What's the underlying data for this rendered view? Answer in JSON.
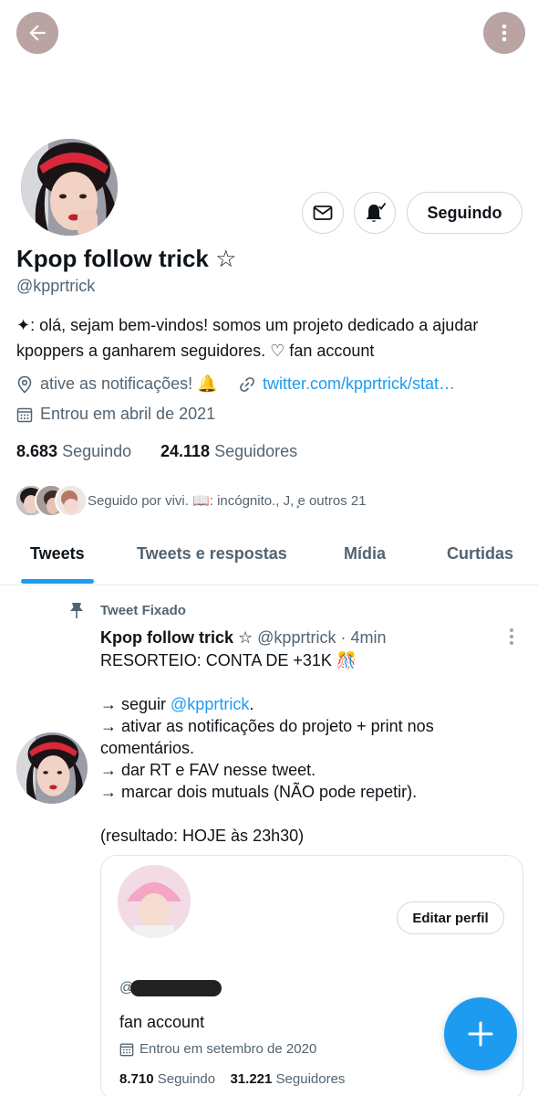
{
  "profile": {
    "name": "Kpop follow trick",
    "name_symbol": "☆",
    "handle": "@kpprtrick",
    "bio_line1": "✦: olá, sejam bem-vindos! somos um projeto dedicado a ajudar",
    "bio_line2": "kpoppers a ganharem seguidores. ♡ fan account",
    "location": "ative as notificações! 🔔",
    "website": "twitter.com/kpprtrick/stat…",
    "joined": "Entrou em abril de 2021",
    "following_count": "8.683",
    "following_label": "Seguindo",
    "followers_count": "24.118",
    "followers_label": "Seguidores",
    "followed_by": "Seguido por vivi. 📖: incógnito., J, ̧e outros 21",
    "follow_button": "Seguindo"
  },
  "tabs": [
    {
      "label": "Tweets",
      "active": true
    },
    {
      "label": "Tweets e respostas",
      "active": false
    },
    {
      "label": "Mídia",
      "active": false
    },
    {
      "label": "Curtidas",
      "active": false
    }
  ],
  "tweet": {
    "pinned_label": "Tweet Fixado",
    "author": "Kpop follow trick ☆",
    "handle": "@kpprtrick",
    "time": "· 4min",
    "line1": "RESORTEIO: CONTA DE +31K 🎊",
    "line2a": "→ seguir ",
    "line2_mention": "@kpprtrick",
    "line2b": ".",
    "line3": "→ ativar as notificações do projeto + print nos",
    "line4": "comentários.",
    "line5": "→ dar RT e FAV nesse tweet.",
    "line6": "→ marcar dois mutuals (NÃO pode repetir).",
    "line7": "(resultado: HOJE às 23h30)"
  },
  "embedded": {
    "edit_button": "Editar perfil",
    "handle_prefix": "@",
    "bio": "fan account",
    "joined": "Entrou em setembro de 2020",
    "following_count": "8.710",
    "following_label": "Seguindo",
    "followers_count": "31.221",
    "followers_label": "Seguidores"
  },
  "colors": {
    "accent": "#1d9bf0",
    "header_button": "#b9a3a3",
    "headband": "#d8283a"
  }
}
